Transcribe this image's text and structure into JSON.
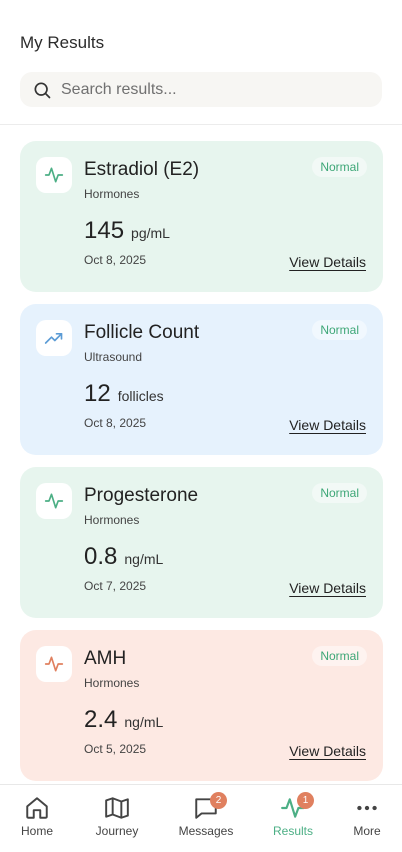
{
  "header": {
    "title": "My Results",
    "search_placeholder": "Search results..."
  },
  "results": [
    {
      "name": "Estradiol (E2)",
      "category": "Hormones",
      "value": "145",
      "unit": "pg/mL",
      "date": "Oct 8, 2025",
      "status": "Normal",
      "details_label": "View Details",
      "icon": "activity-icon",
      "theme": "green",
      "icon_color": "#4caf85"
    },
    {
      "name": "Follicle Count",
      "category": "Ultrasound",
      "value": "12",
      "unit": "follicles",
      "date": "Oct 8, 2025",
      "status": "Normal",
      "details_label": "View Details",
      "icon": "trending-up-icon",
      "theme": "blue",
      "icon_color": "#5b9bd5"
    },
    {
      "name": "Progesterone",
      "category": "Hormones",
      "value": "0.8",
      "unit": "ng/mL",
      "date": "Oct 7, 2025",
      "status": "Normal",
      "details_label": "View Details",
      "icon": "activity-icon",
      "theme": "green",
      "icon_color": "#4caf85"
    },
    {
      "name": "AMH",
      "category": "Hormones",
      "value": "2.4",
      "unit": "ng/mL",
      "date": "Oct 5, 2025",
      "status": "Normal",
      "details_label": "View Details",
      "icon": "activity-icon",
      "theme": "peach",
      "icon_color": "#e0805f"
    }
  ],
  "tabs": [
    {
      "label": "Home",
      "icon": "home-icon"
    },
    {
      "label": "Journey",
      "icon": "map-icon"
    },
    {
      "label": "Messages",
      "icon": "message-icon",
      "badge": "2"
    },
    {
      "label": "Results",
      "icon": "activity-icon",
      "badge": "1",
      "active": true
    },
    {
      "label": "More",
      "icon": "more-icon"
    }
  ],
  "colors": {
    "accent_green": "#4caf85",
    "badge": "#e0805f",
    "card_green": "#e7f5ee",
    "card_blue": "#e6f2fd",
    "card_peach": "#fde9e3"
  }
}
